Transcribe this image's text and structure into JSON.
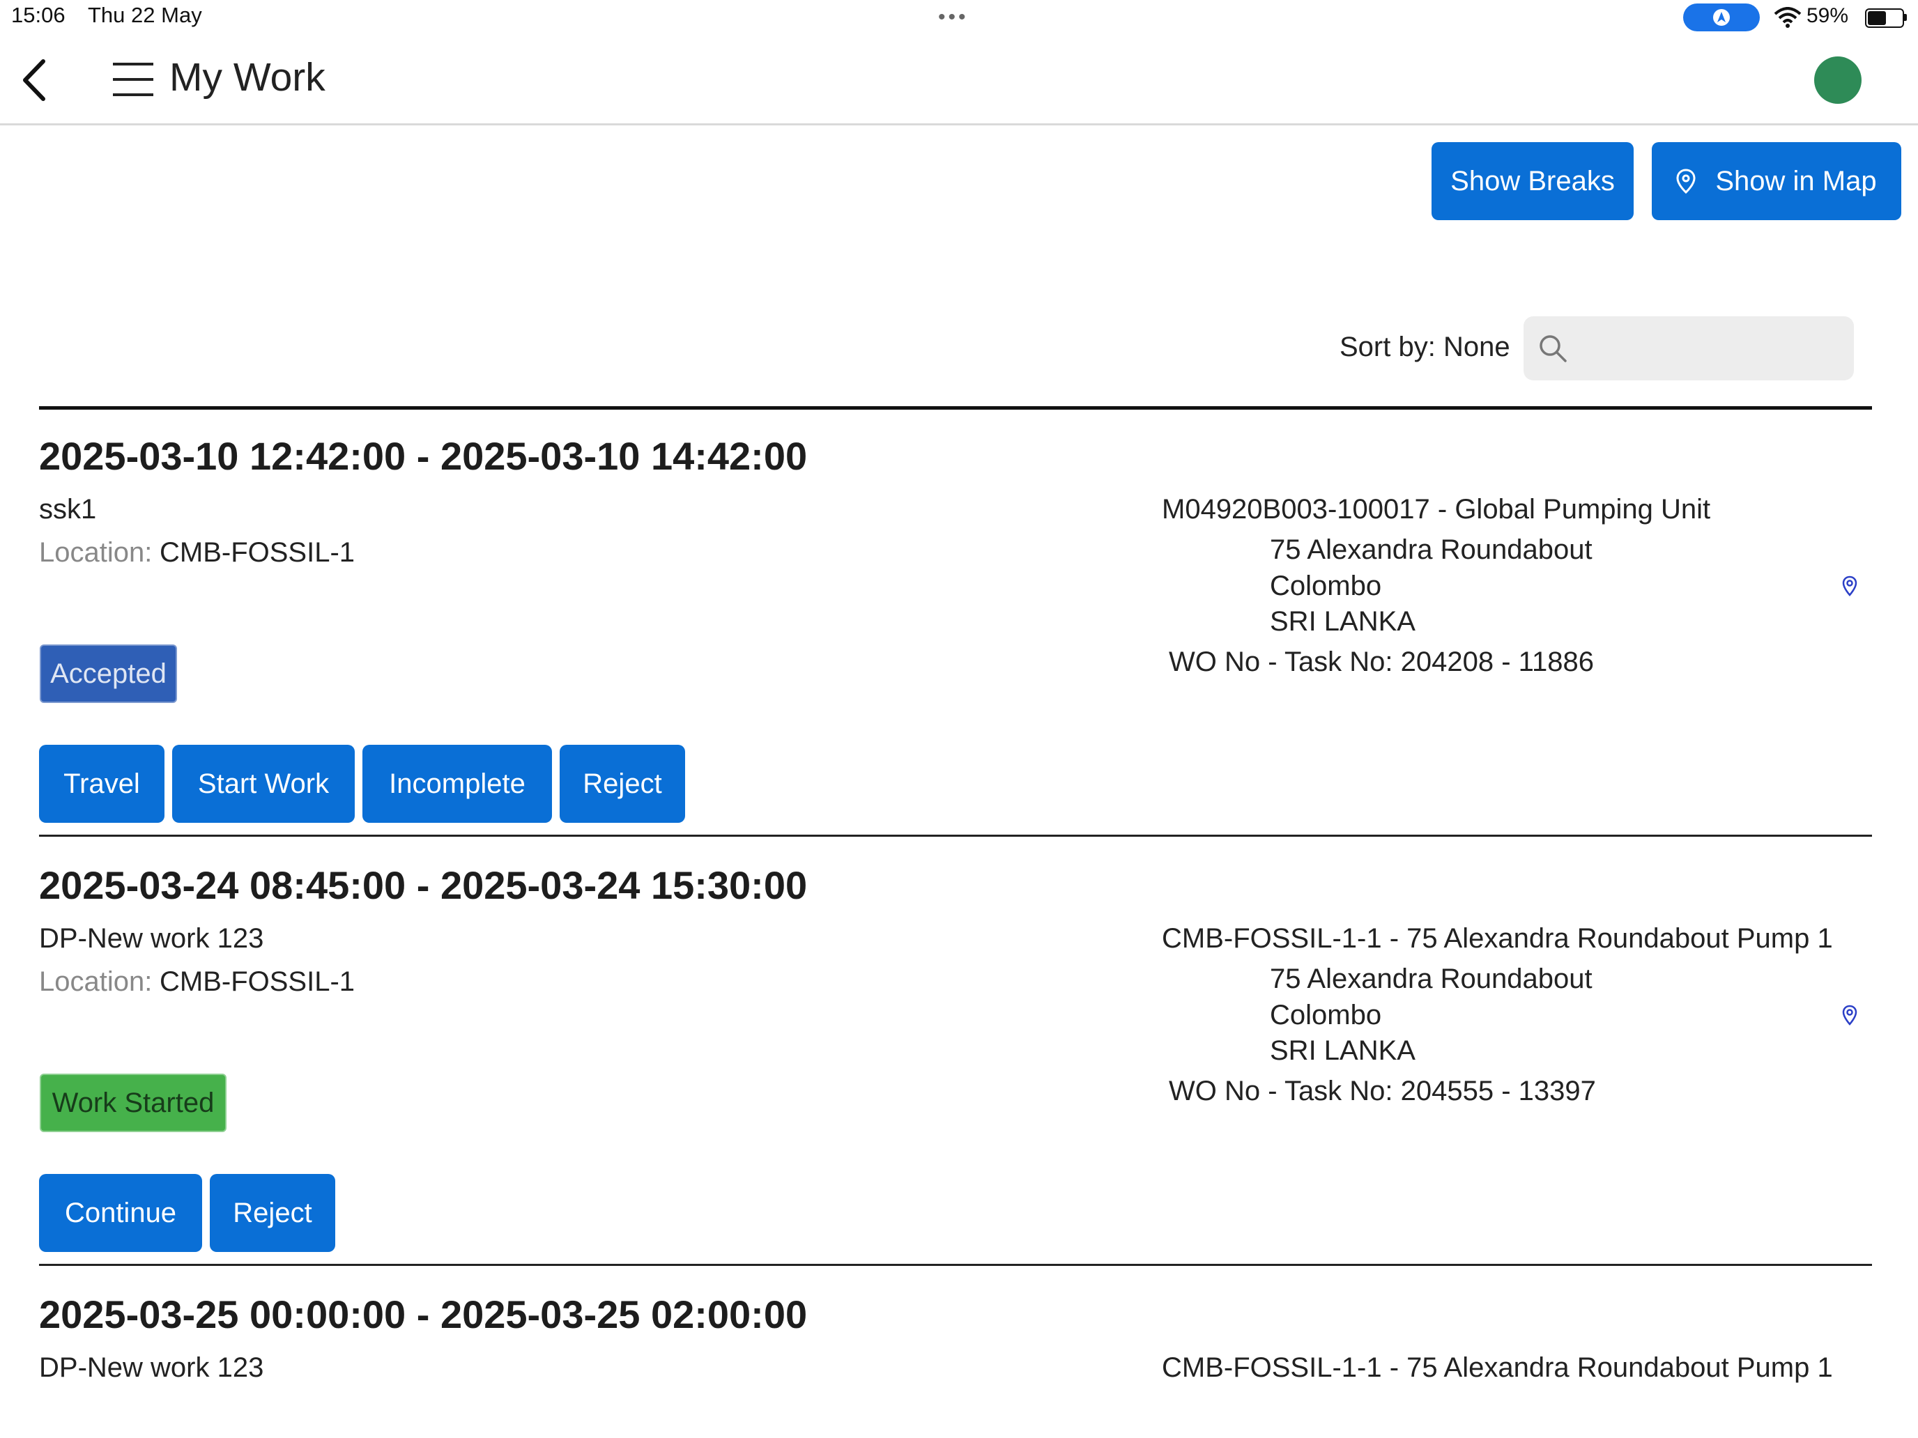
{
  "status_bar": {
    "time": "15:06",
    "date": "Thu 22 May",
    "battery": "59%",
    "battery_level": 0.59
  },
  "header": {
    "title": "My Work"
  },
  "toolbar": {
    "show_breaks": "Show Breaks",
    "show_in_map": "Show in Map"
  },
  "sort": {
    "label": "Sort by: None",
    "search_placeholder": ""
  },
  "location_label": "Location:",
  "cards": [
    {
      "time_range": "2025-03-10 12:42:00 - 2025-03-10 14:42:00",
      "name": "ssk1",
      "location": "CMB-FOSSIL-1",
      "asset": "M04920B003-100017 - Global Pumping Unit",
      "address": [
        "75 Alexandra Roundabout",
        "Colombo",
        "SRI LANKA"
      ],
      "wo": "WO No - Task No: 204208 - 11886",
      "status": "Accepted",
      "actions": [
        "Travel",
        "Start Work",
        "Incomplete",
        "Reject"
      ]
    },
    {
      "time_range": "2025-03-24 08:45:00 - 2025-03-24 15:30:00",
      "name": "DP-New work 123",
      "location": "CMB-FOSSIL-1",
      "asset": "CMB-FOSSIL-1-1 - 75 Alexandra Roundabout Pump 1",
      "address": [
        "75 Alexandra Roundabout",
        "Colombo",
        "SRI LANKA"
      ],
      "wo": "WO No - Task No: 204555 - 13397",
      "status": "Work Started",
      "actions": [
        "Continue",
        "Reject"
      ]
    },
    {
      "time_range": "2025-03-25 00:00:00 - 2025-03-25 02:00:00",
      "name": "DP-New work 123",
      "asset": "CMB-FOSSIL-1-1 - 75 Alexandra Roundabout Pump 1"
    }
  ],
  "colors": {
    "primary": "#0a6fd6",
    "accepted": "#2f5fb6",
    "started": "#46b14b",
    "avatar": "#2e8b57"
  }
}
